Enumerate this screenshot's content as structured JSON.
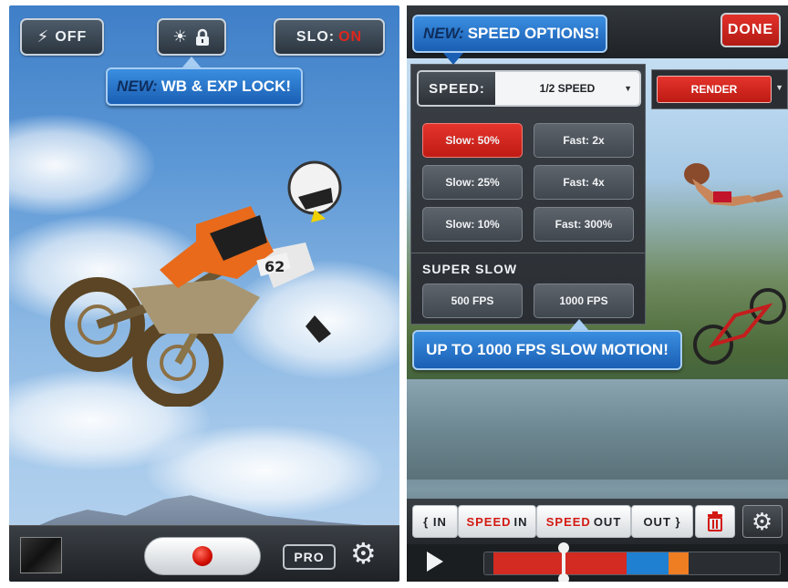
{
  "left": {
    "top_buttons": {
      "flash_label": "OFF",
      "lock_label": "",
      "slo_label": "SLO:",
      "slo_value": "ON"
    },
    "tooltip": {
      "prefix": "NEW:",
      "text": "WB & EXP LOCK!"
    },
    "bottom": {
      "pro_label": "PRO"
    }
  },
  "right": {
    "tooltip_top": {
      "prefix": "NEW:",
      "text": "SPEED OPTIONS!"
    },
    "done_label": "DONE",
    "speed": {
      "label": "SPEED:",
      "selected": "1/2 SPEED"
    },
    "render_label": "RENDER",
    "options": [
      {
        "label": "Slow: 50%",
        "active": true
      },
      {
        "label": "Fast: 2x",
        "active": false
      },
      {
        "label": "Slow: 25%",
        "active": false
      },
      {
        "label": "Fast: 4x",
        "active": false
      },
      {
        "label": "Slow: 10%",
        "active": false
      },
      {
        "label": "Fast: 300%",
        "active": false
      }
    ],
    "super_slow": {
      "label": "SUPER SLOW",
      "options": [
        "500 FPS",
        "1000 FPS"
      ]
    },
    "tooltip_bottom": {
      "text": "UP TO 1000 FPS SLOW MOTION!"
    },
    "edit_bar": {
      "in_label": "{ IN",
      "speed_in_prefix": "SPEED",
      "speed_in_suffix": "IN",
      "speed_out_prefix": "SPEED",
      "speed_out_suffix": "OUT",
      "out_label": "OUT }"
    },
    "timeline_colors": [
      "#d32a22",
      "#1f7fd0",
      "#ef7d22"
    ],
    "accent": "#d31a12",
    "tooltip_blue": "#1a5fb4"
  }
}
